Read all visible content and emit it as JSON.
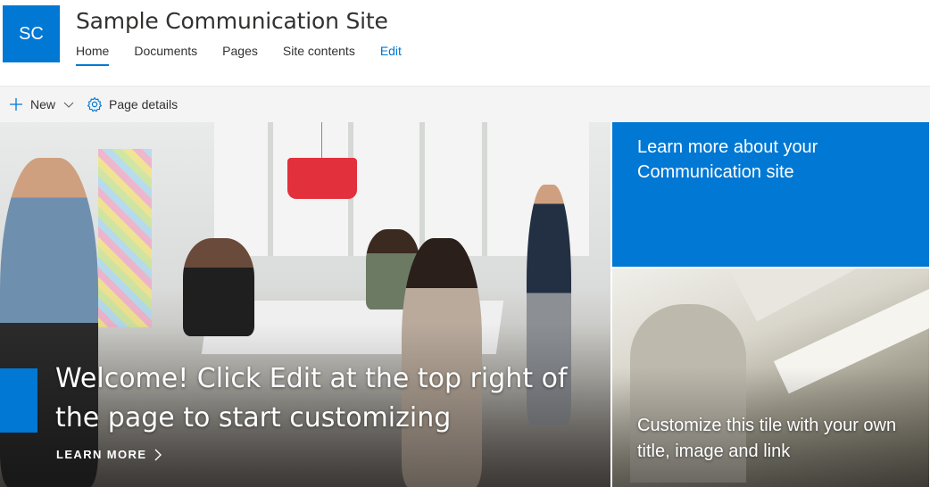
{
  "site": {
    "logo_initials": "SC",
    "title": "Sample Communication Site"
  },
  "nav": {
    "items": [
      {
        "label": "Home",
        "active": true
      },
      {
        "label": "Documents"
      },
      {
        "label": "Pages"
      },
      {
        "label": "Site contents"
      }
    ],
    "edit_label": "Edit"
  },
  "command_bar": {
    "new_label": "New",
    "page_details_label": "Page details"
  },
  "hero": {
    "main": {
      "title": "Welcome! Click Edit at the top right of the page to start customizing",
      "link_label": "LEARN MORE"
    },
    "tile_top": {
      "text": "Learn more about your Communication site"
    },
    "tile_bottom": {
      "text": "Customize this tile with your own title, image and link"
    }
  },
  "icons": {
    "plus": "plus-icon",
    "chevron_down": "chevron-down-icon",
    "gear": "gear-icon",
    "chevron_right": "chevron-right-icon"
  },
  "colors": {
    "accent": "#0078d4",
    "command_bar_bg": "#f4f4f4",
    "text": "#323130",
    "white": "#ffffff"
  }
}
